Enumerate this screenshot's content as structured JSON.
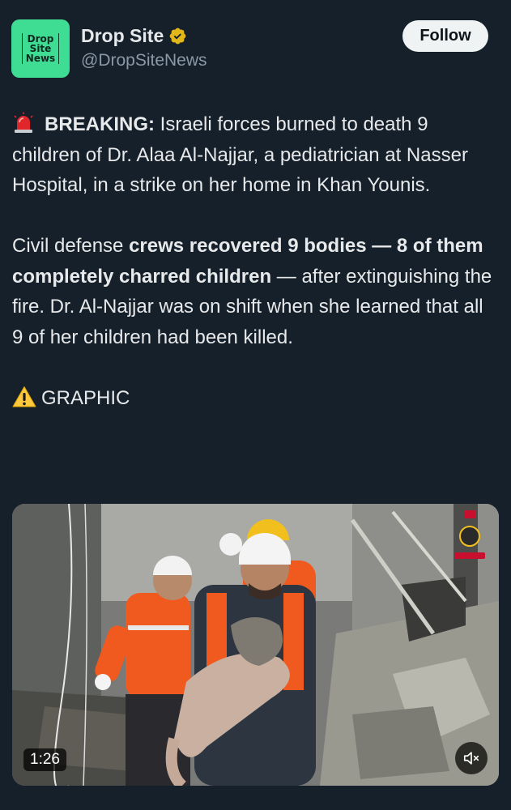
{
  "author": {
    "display_name": "Drop Site",
    "handle": "@DropSiteNews",
    "avatar_text": [
      "Drop",
      "Site",
      "News"
    ],
    "verified": true
  },
  "follow_label": "Follow",
  "tweet": {
    "p1_lead_bold": "BREAKING:",
    "p1_text": " Israeli forces burned to death 9 children of Dr. Alaa Al-Najjar, a pediatrician at Nasser Hospital, in a strike on her home in Khan Younis.",
    "p2_text1": "Civil defense ",
    "p2_bold": "crews recovered 9 bodies — 8 of them completely charred children",
    "p2_text2": " — after extinguishing the fire. Dr. Al-Najjar was on shift when she learned that all 9 of her children had been killed.",
    "p3_text": "GRAPHIC"
  },
  "media": {
    "duration": "1:26"
  },
  "icons": {
    "breaking": "rotating-light-icon",
    "warning": "warning-icon",
    "verified": "verified-badge-icon",
    "mute": "speaker-muted-icon"
  },
  "colors": {
    "background": "#15202b",
    "text": "#e7e9ea",
    "secondary_text": "#8b98a5",
    "avatar": "#3fdc94",
    "verified": "#e2b719"
  }
}
